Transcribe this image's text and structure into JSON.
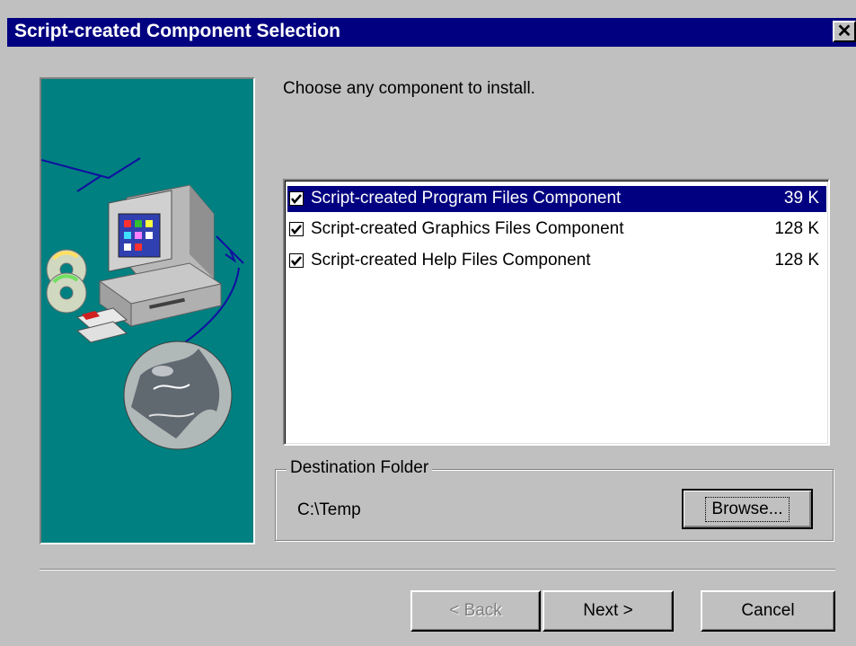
{
  "window": {
    "title": "Script-created Component Selection",
    "close_glyph": "✕"
  },
  "instruction": "Choose any component to install.",
  "components": [
    {
      "label": "Script-created Program Files Component",
      "size": "39 K",
      "checked": true,
      "selected": true
    },
    {
      "label": "Script-created Graphics Files Component",
      "size": "128 K",
      "checked": true,
      "selected": false
    },
    {
      "label": "Script-created Help Files Component",
      "size": "128 K",
      "checked": true,
      "selected": false
    }
  ],
  "destination": {
    "legend": "Destination Folder",
    "path": "C:\\Temp",
    "browse_label": "Browse..."
  },
  "buttons": {
    "back_label": "< Back",
    "next_label": "Next >",
    "cancel_label": "Cancel"
  },
  "colors": {
    "titlebar": "#000080",
    "face": "#c0c0c0",
    "image_bg": "#008080",
    "selection": "#000080"
  }
}
